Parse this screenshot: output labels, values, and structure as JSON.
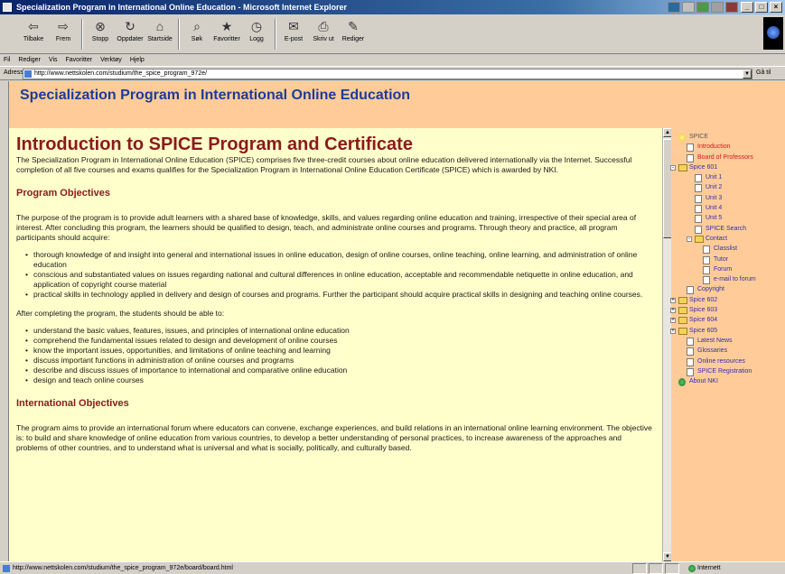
{
  "window": {
    "title": "Specialization Program in International Online Education - Microsoft Internet Explorer"
  },
  "toolbar": {
    "buttons": [
      {
        "label": "Tilbake",
        "icon": "back-arrow-icon"
      },
      {
        "label": "Frem",
        "icon": "forward-arrow-icon"
      },
      {
        "label": "Stopp",
        "icon": "stop-icon"
      },
      {
        "label": "Oppdater",
        "icon": "refresh-icon"
      },
      {
        "label": "Startside",
        "icon": "home-icon"
      },
      {
        "label": "Søk",
        "icon": "search-icon"
      },
      {
        "label": "Favoritter",
        "icon": "favorites-icon"
      },
      {
        "label": "Logg",
        "icon": "history-icon"
      },
      {
        "label": "E-post",
        "icon": "mail-icon"
      },
      {
        "label": "Skriv ut",
        "icon": "print-icon"
      },
      {
        "label": "Rediger",
        "icon": "edit-icon"
      }
    ]
  },
  "menubar": {
    "items": [
      "Fil",
      "Rediger",
      "Vis",
      "Favoritter",
      "Verktøy",
      "Hjelp"
    ]
  },
  "address": {
    "label": "Adresse",
    "url": "http://www.nettskolen.com/studium/the_spice_program_972e/",
    "go_label": "Gå til"
  },
  "header": {
    "site_title": "Specialization Program in International Online Education"
  },
  "main": {
    "title": "Introduction to SPICE Program and Certificate",
    "intro": "The Specialization Program in International Online Education (SPICE) comprises five three-credit courses about online education delivered internationally via the Internet. Successful completion of all five courses and exams qualifies for the Specialization Program in International Online Education Certificate (SPICE) which is awarded by NKI.",
    "objectives_heading": "Program Objectives",
    "objectives_text": "The purpose of the program is to provide adult learners with a shared base of knowledge, skills, and values regarding online education and training, irrespective of their special area of interest. After concluding this program, the learners should be qualified to design, teach, and administrate online courses and programs. Through theory and practice, all program participants should acquire:",
    "objectives_list": [
      "thorough knowledge of and insight into general and international issues in online education, design of online courses, online teaching, online learning, and administration of online education",
      "conscious and substantiated values on issues regarding national and cultural differences in online education, acceptable and recommendable netiquette in online education, and application of copyright course material",
      "practical skills in technology applied in delivery and design of courses and programs. Further the participant should acquire practical skills in designing and teaching online courses."
    ],
    "after_text": "After completing the program, the students should be able to:",
    "able_list": [
      "understand the basic values, features, issues, and principles of international online education",
      "comprehend the fundamental issues related to design and development of online courses",
      "know the important issues, opportunities, and limitations of online teaching and learning",
      "discuss important functions in administration of online courses and programs",
      "describe and discuss issues of importance to international and comparative online education",
      "design and teach online courses"
    ],
    "intl_heading": "International Objectives",
    "intl_text": "The program aims to provide an international forum where educators can convene, exchange experiences, and build relations in an international online learning environment. The objective is: to build and share knowledge of online education from various countries, to develop a better understanding of personal practices, to increase awareness of the approaches and problems of other countries, and to understand what is universal and what is socially, politically, and culturally based."
  },
  "nav": {
    "items": [
      {
        "label": "SPICE",
        "icon": "bulb-icon"
      },
      {
        "label": "Introduction",
        "icon": "page-icon"
      },
      {
        "label": "Board of Professors",
        "icon": "page-icon"
      },
      {
        "label": "Spice 601",
        "icon": "folder-icon",
        "toggle": "-"
      },
      {
        "label": "Unit 1",
        "icon": "page-icon"
      },
      {
        "label": "Unit 2",
        "icon": "page-icon"
      },
      {
        "label": "Unit 3",
        "icon": "page-icon"
      },
      {
        "label": "Unit 4",
        "icon": "page-icon"
      },
      {
        "label": "Unit 5",
        "icon": "page-icon"
      },
      {
        "label": "SPICE Search",
        "icon": "page-icon"
      },
      {
        "label": "Contact",
        "icon": "folder-icon",
        "toggle": "-"
      },
      {
        "label": "Classlist",
        "icon": "page-icon"
      },
      {
        "label": "Tutor",
        "icon": "page-icon"
      },
      {
        "label": "Forum",
        "icon": "page-icon"
      },
      {
        "label": "e-mail to forum",
        "icon": "page-icon"
      },
      {
        "label": "Copyright",
        "icon": "page-icon"
      },
      {
        "label": "Spice 602",
        "icon": "folder-icon",
        "toggle": "+"
      },
      {
        "label": "Spice 603",
        "icon": "folder-icon",
        "toggle": "+"
      },
      {
        "label": "Spice 604",
        "icon": "folder-icon",
        "toggle": "+"
      },
      {
        "label": "Spice 605",
        "icon": "folder-icon",
        "toggle": "+"
      },
      {
        "label": "Latest News",
        "icon": "page-icon"
      },
      {
        "label": "Glossaries",
        "icon": "page-icon"
      },
      {
        "label": "Online resources",
        "icon": "page-icon"
      },
      {
        "label": "SPICE Registration",
        "icon": "page-icon"
      },
      {
        "label": "About NKI",
        "icon": "globe-icon"
      }
    ]
  },
  "status": {
    "text": "http://www.nettskolen.com/studium/the_spice_program_972e/board/board.html",
    "zone": "Internett"
  },
  "colors": {
    "header_bg": "#ffcc99",
    "content_bg": "#ffffcc",
    "title_red": "#8b1a1a",
    "site_title_blue": "#1a3c9a",
    "nav_link_blue": "#2f2fb0",
    "nav_link_red": "#d11a1a"
  }
}
